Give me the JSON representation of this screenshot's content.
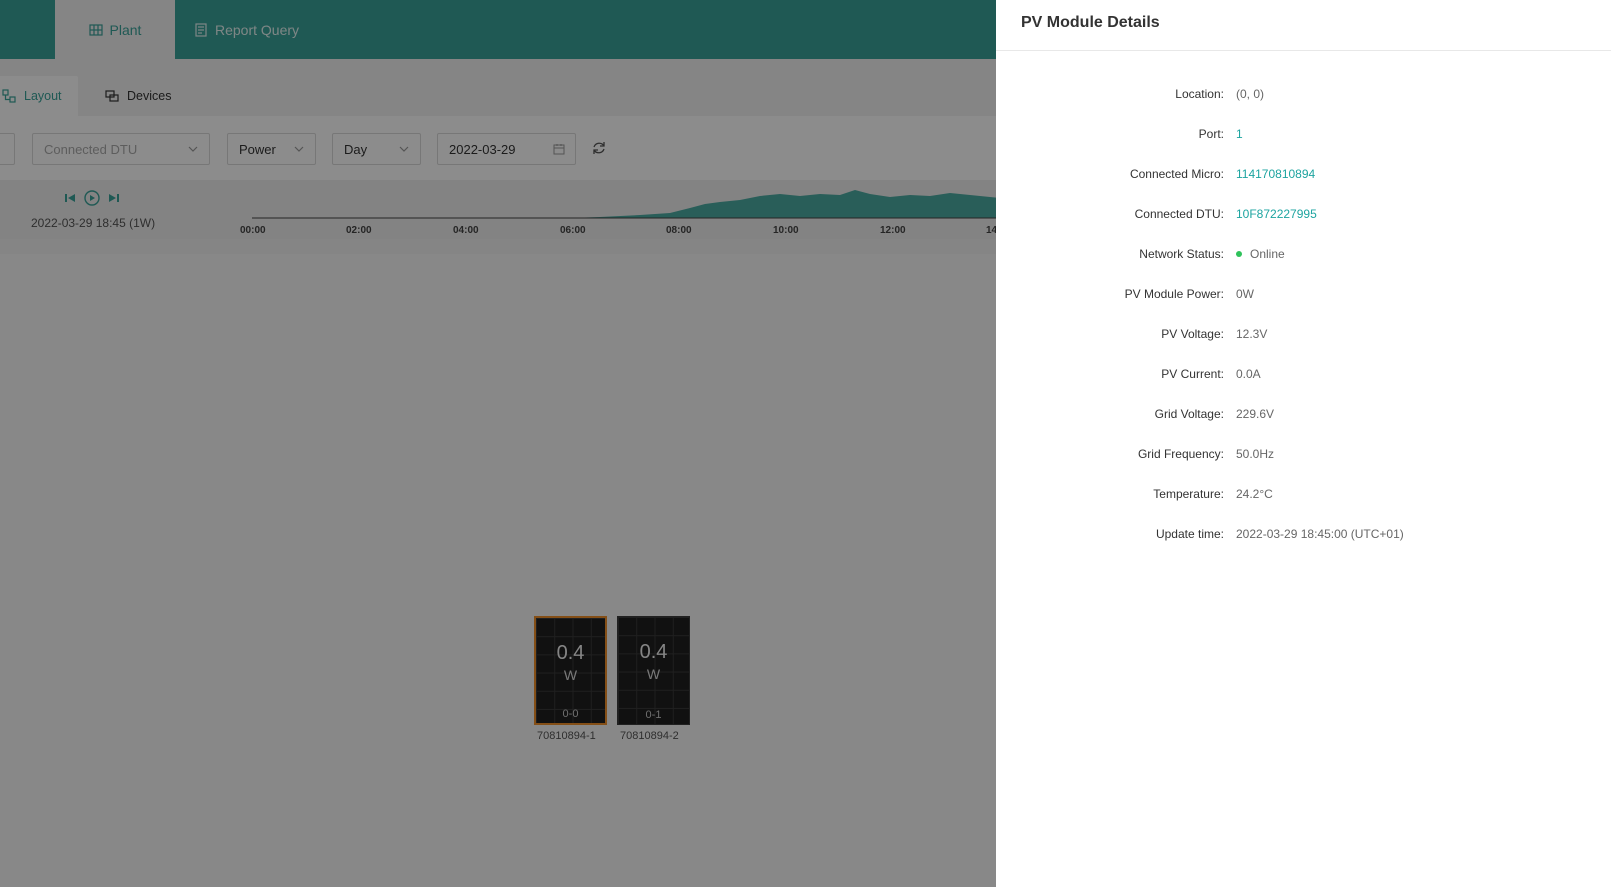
{
  "nav": {
    "tabs": [
      {
        "label": "Plant",
        "icon": "plant-icon",
        "active": true
      },
      {
        "label": "Report Query",
        "icon": "report-icon",
        "active": false
      }
    ]
  },
  "subtabs": [
    {
      "label": "Layout",
      "icon": "layout-icon",
      "active": true
    },
    {
      "label": "Devices",
      "icon": "devices-icon",
      "active": false
    }
  ],
  "filters": {
    "dtu_placeholder": "Connected DTU",
    "metric": "Power",
    "period": "Day",
    "date": "2022-03-29"
  },
  "timeline": {
    "current": "2022-03-29 18:45 (1W)",
    "ticks": [
      "00:00",
      "02:00",
      "04:00",
      "06:00",
      "08:00",
      "10:00",
      "12:00",
      "14"
    ]
  },
  "panels": [
    {
      "power": "0.4",
      "unit": "W",
      "position": "0-0",
      "serial": "70810894-1",
      "selected": true
    },
    {
      "power": "0.4",
      "unit": "W",
      "position": "0-1",
      "serial": "70810894-2",
      "selected": false
    }
  ],
  "drawer": {
    "title": "PV Module Details",
    "fields": [
      {
        "label": "Location",
        "value": "(0, 0)",
        "link": false
      },
      {
        "label": "Port",
        "value": "1",
        "link": true
      },
      {
        "label": "Connected Micro",
        "value": "114170810894",
        "link": true
      },
      {
        "label": "Connected DTU",
        "value": "10F872227995",
        "link": true
      },
      {
        "label": "Network Status",
        "value": "Online",
        "link": false,
        "status": true
      },
      {
        "label": "PV Module Power",
        "value": "0W",
        "link": false
      },
      {
        "label": "PV Voltage",
        "value": "12.3V",
        "link": false
      },
      {
        "label": "PV Current",
        "value": "0.0A",
        "link": false
      },
      {
        "label": "Grid Voltage",
        "value": "229.6V",
        "link": false
      },
      {
        "label": "Grid Frequency",
        "value": "50.0Hz",
        "link": false
      },
      {
        "label": "Temperature",
        "value": "24.2°C",
        "link": false
      },
      {
        "label": "Update time",
        "value": "2022-03-29 18:45:00 (UTC+01)",
        "link": false
      }
    ],
    "colors": {
      "link": "#1da4a0",
      "online": "#2fc25b",
      "accent": "#3aa39a"
    }
  }
}
